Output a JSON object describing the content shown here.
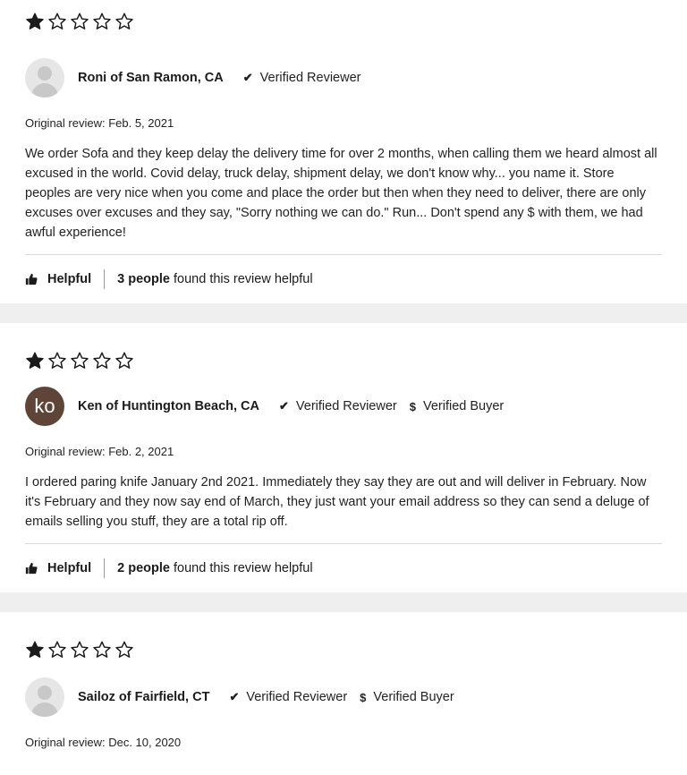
{
  "reviews": [
    {
      "rating": 1,
      "author": "Roni of San Ramon, CA",
      "avatar": {
        "type": "placeholder",
        "initials": ""
      },
      "badges": {
        "verified_reviewer": "Verified Reviewer",
        "verified_buyer": ""
      },
      "date": "Original review: Feb. 5, 2021",
      "text": "We order Sofa and they keep delay the delivery time for over 2 months, when calling them we heard almost all excused in the world. Covid delay, truck delay, shipment delay, we don't know why... you name it. Store peoples are very nice when you come and place the order but then when they need to deliver, there are only excuses over excuses and they say, \"Sorry nothing we can do.\" Run... Don't spend any $ with them, we had awful experience!",
      "helpful_label": "Helpful",
      "helpful_count": "3 people",
      "helpful_suffix": "found this review helpful"
    },
    {
      "rating": 1,
      "author": "Ken of Huntington Beach, CA",
      "avatar": {
        "type": "initials",
        "initials": "ko"
      },
      "badges": {
        "verified_reviewer": "Verified Reviewer",
        "verified_buyer": "Verified Buyer"
      },
      "date": "Original review: Feb. 2, 2021",
      "text": "I ordered paring knife January 2nd 2021. Immediately they say they are out and will deliver in February. Now it's February and they now say end of March, they just want your email address so they can send a deluge of emails selling you stuff, they are a total rip off.",
      "helpful_label": "Helpful",
      "helpful_count": "2 people",
      "helpful_suffix": "found this review helpful"
    },
    {
      "rating": 1,
      "author": "Sailoz of Fairfield, CT",
      "avatar": {
        "type": "placeholder",
        "initials": ""
      },
      "badges": {
        "verified_reviewer": "Verified Reviewer",
        "verified_buyer": "Verified Buyer"
      },
      "date": "Original review: Dec. 10, 2020"
    }
  ],
  "icons": {
    "star": "star-icon",
    "check": "checkmark-icon",
    "dollar": "dollar-icon",
    "thumb": "thumbs-up-icon"
  },
  "colors": {
    "band": "#efefef",
    "avatar_initials_bg": "#5e4537",
    "star": "#1b1b1b"
  }
}
